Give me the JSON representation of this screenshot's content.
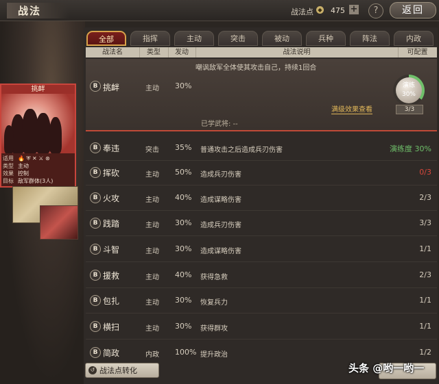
{
  "topbar": {
    "title": "战法",
    "points_label": "战法点",
    "points_icon": "strategy-point-icon",
    "points_value": "475",
    "plus": "+",
    "help": "?",
    "back": "返回"
  },
  "card": {
    "name": "挑衅",
    "icons": "🔥 ⛨ ✕ ⚔ ⊛",
    "info": [
      {
        "k": "适用",
        "v": ""
      },
      {
        "k": "类型",
        "v": "主动"
      },
      {
        "k": "效果",
        "v": "控制"
      },
      {
        "k": "目标",
        "v": "敌军群体(3人)"
      }
    ]
  },
  "tabs": [
    "全部",
    "指挥",
    "主动",
    "突击",
    "被动",
    "兵种",
    "阵法",
    "内政"
  ],
  "table": {
    "headers": [
      "战法名",
      "类型",
      "发动",
      "战法说明",
      "可配置"
    ],
    "expanded": {
      "icon": "B",
      "name": "挑衅",
      "type": "主动",
      "cost": "30%",
      "desc": "嘲讽敌军全体使其攻击自己，持续1回合",
      "full_effect": "满级效果查看",
      "learned": "已学武将: --",
      "mastery_label": "演练",
      "mastery_value": "30%",
      "count": "3/3"
    },
    "rows": [
      {
        "icon": "B",
        "name": "奉违",
        "type": "突击",
        "cost": "35%",
        "desc": "普通攻击之后造成兵刃伤害",
        "conf": "演练度 30%",
        "conf_color": "#6fc06a"
      },
      {
        "icon": "B",
        "name": "挥砍",
        "type": "主动",
        "cost": "50%",
        "desc": "造成兵刃伤害",
        "conf": "0/3",
        "conf_color": "#d8463a"
      },
      {
        "icon": "B",
        "name": "火攻",
        "type": "主动",
        "cost": "40%",
        "desc": "造成谋略伤害",
        "conf": "2/3",
        "conf_color": "#e6dccb"
      },
      {
        "icon": "B",
        "name": "践踏",
        "type": "主动",
        "cost": "30%",
        "desc": "造成兵刃伤害",
        "conf": "3/3",
        "conf_color": "#e6dccb"
      },
      {
        "icon": "B",
        "name": "斗智",
        "type": "主动",
        "cost": "30%",
        "desc": "造成谋略伤害",
        "conf": "1/1",
        "conf_color": "#e6dccb"
      },
      {
        "icon": "B",
        "name": "援救",
        "type": "主动",
        "cost": "40%",
        "desc": "获得急救",
        "conf": "2/3",
        "conf_color": "#e6dccb"
      },
      {
        "icon": "B",
        "name": "包扎",
        "type": "主动",
        "cost": "30%",
        "desc": "恢复兵力",
        "conf": "1/1",
        "conf_color": "#e6dccb"
      },
      {
        "icon": "B",
        "name": "横扫",
        "type": "主动",
        "cost": "30%",
        "desc": "获得群攻",
        "conf": "1/1",
        "conf_color": "#e6dccb"
      },
      {
        "icon": "B",
        "name": "简政",
        "type": "内政",
        "cost": "100%",
        "desc": "提升政治",
        "conf": "1/2",
        "conf_color": "#e6dccb"
      }
    ]
  },
  "bottom": {
    "convert_icon": "↺",
    "convert_label": "战法点转化"
  },
  "watermark": "头条 @哟一哟一"
}
